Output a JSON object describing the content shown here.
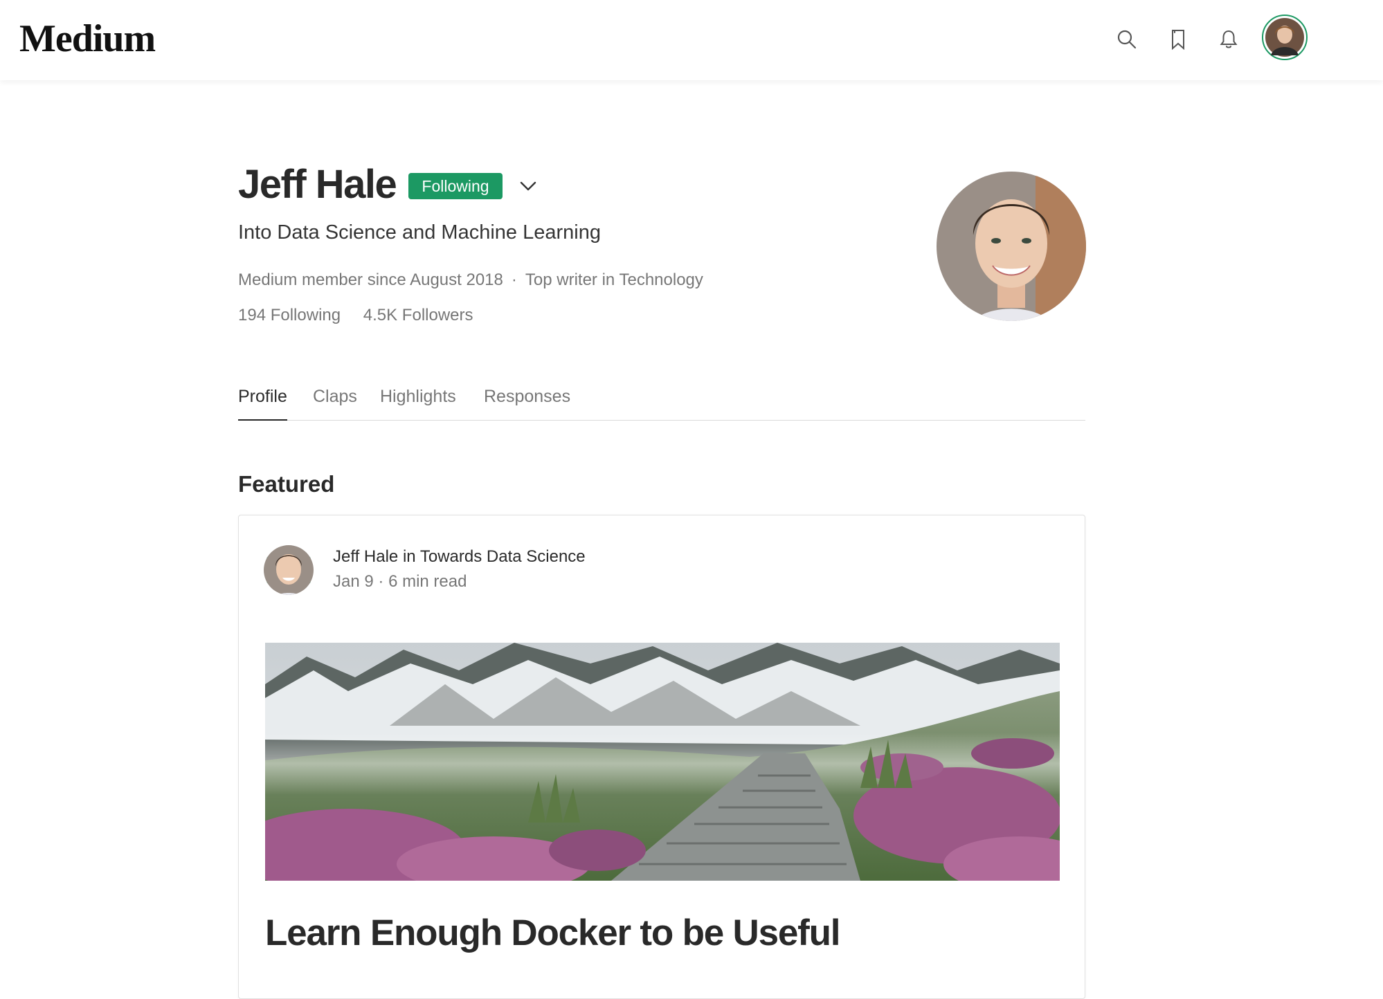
{
  "topbar": {
    "logo": "Medium",
    "icons": [
      "search-icon",
      "bookmark-icon",
      "bell-icon"
    ],
    "user_avatar": "user-avatar"
  },
  "profile": {
    "name": "Jeff Hale",
    "follow_label": "Following",
    "bio": "Into Data Science and Machine Learning",
    "member_since": "Medium member since August 2018",
    "separator": "·",
    "top_writer": "Top writer in Technology",
    "following": "194 Following",
    "followers": "4.5K Followers",
    "accent_color": "#1c9963"
  },
  "tabs": [
    {
      "label": "Profile",
      "active": true
    },
    {
      "label": "Claps",
      "active": false
    },
    {
      "label": "Highlights",
      "active": false
    },
    {
      "label": "Responses",
      "active": false
    }
  ],
  "featured": {
    "heading": "Featured",
    "post": {
      "author": "Jeff Hale",
      "connector": "in",
      "publication": "Towards Data Science",
      "date": "Jan 9",
      "read_time": "6 min read",
      "title": "Learn Enough Docker to be Useful"
    }
  }
}
